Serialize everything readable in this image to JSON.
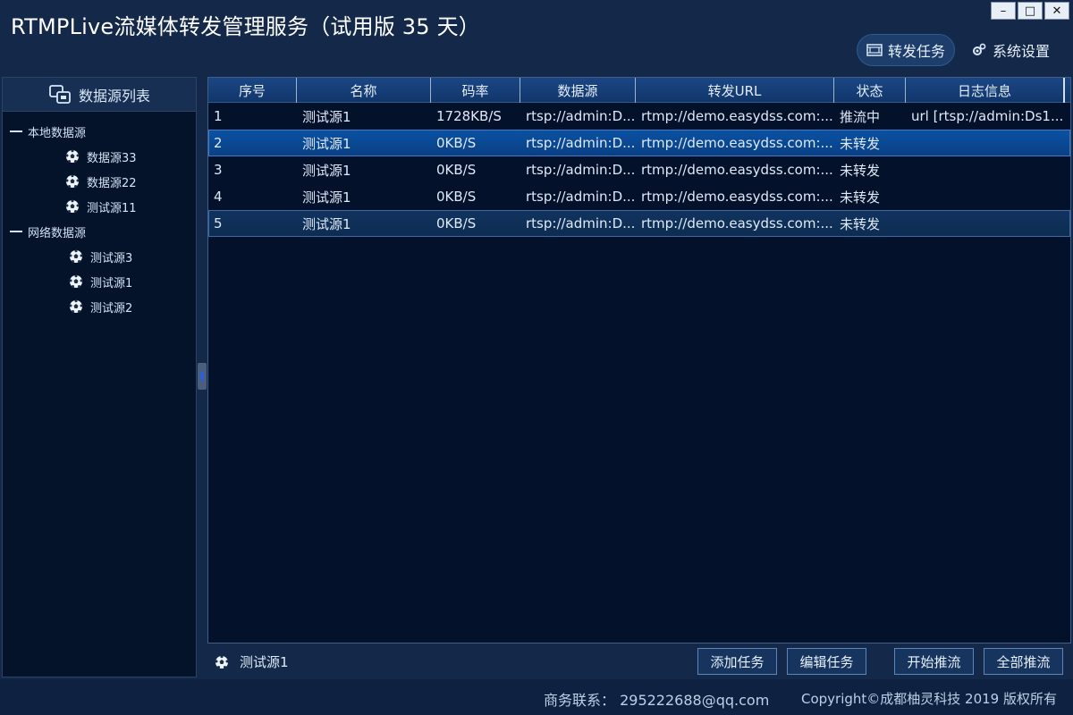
{
  "window": {
    "title": "RTMPLive流媒体转发管理服务（试用版 35 天）",
    "controls": {
      "minimize": "–",
      "maximize": "□",
      "close": "✕"
    }
  },
  "top_nav": {
    "forward_tasks": "转发任务",
    "system_settings": "系统设置"
  },
  "left_panel": {
    "title": "数据源列表",
    "groups": [
      {
        "label": "本地数据源",
        "items": [
          "数据源33",
          "数据源22",
          "测试源11"
        ]
      },
      {
        "label": "网络数据源",
        "items": [
          "测试源3",
          "测试源1",
          "测试源2"
        ]
      }
    ]
  },
  "table": {
    "headers": [
      "序号",
      "名称",
      "码率",
      "数据源",
      "转发URL",
      "状态",
      "日志信息"
    ],
    "rows": [
      [
        "1",
        "测试源1",
        "1728KB/S",
        "rtsp://admin:D...",
        "rtmp://demo.easydss.com:...",
        "推流中",
        "url [rtsp://admin:Ds1..."
      ],
      [
        "2",
        "测试源1",
        "0KB/S",
        "rtsp://admin:D...",
        "rtmp://demo.easydss.com:...",
        "未转发",
        ""
      ],
      [
        "3",
        "测试源1",
        "0KB/S",
        "rtsp://admin:D...",
        "rtmp://demo.easydss.com:...",
        "未转发",
        ""
      ],
      [
        "4",
        "测试源1",
        "0KB/S",
        "rtsp://admin:D...",
        "rtmp://demo.easydss.com:...",
        "未转发",
        ""
      ],
      [
        "5",
        "测试源1",
        "0KB/S",
        "rtsp://admin:D...",
        "rtmp://demo.easydss.com:...",
        "未转发",
        ""
      ]
    ]
  },
  "action_bar": {
    "current_source": "测试源1",
    "add_task": "添加任务",
    "edit_task": "编辑任务",
    "start_push": "开始推流",
    "push_all": "全部推流"
  },
  "status_bar": {
    "contact": "商务联系：  295222688@qq.com",
    "copyright": "Copyright©成都柚灵科技 2019 版权所有"
  },
  "colors": {
    "background": "#14294a",
    "panel": "#03112a",
    "selection": "#0b52a3",
    "header": "#1b4684"
  }
}
